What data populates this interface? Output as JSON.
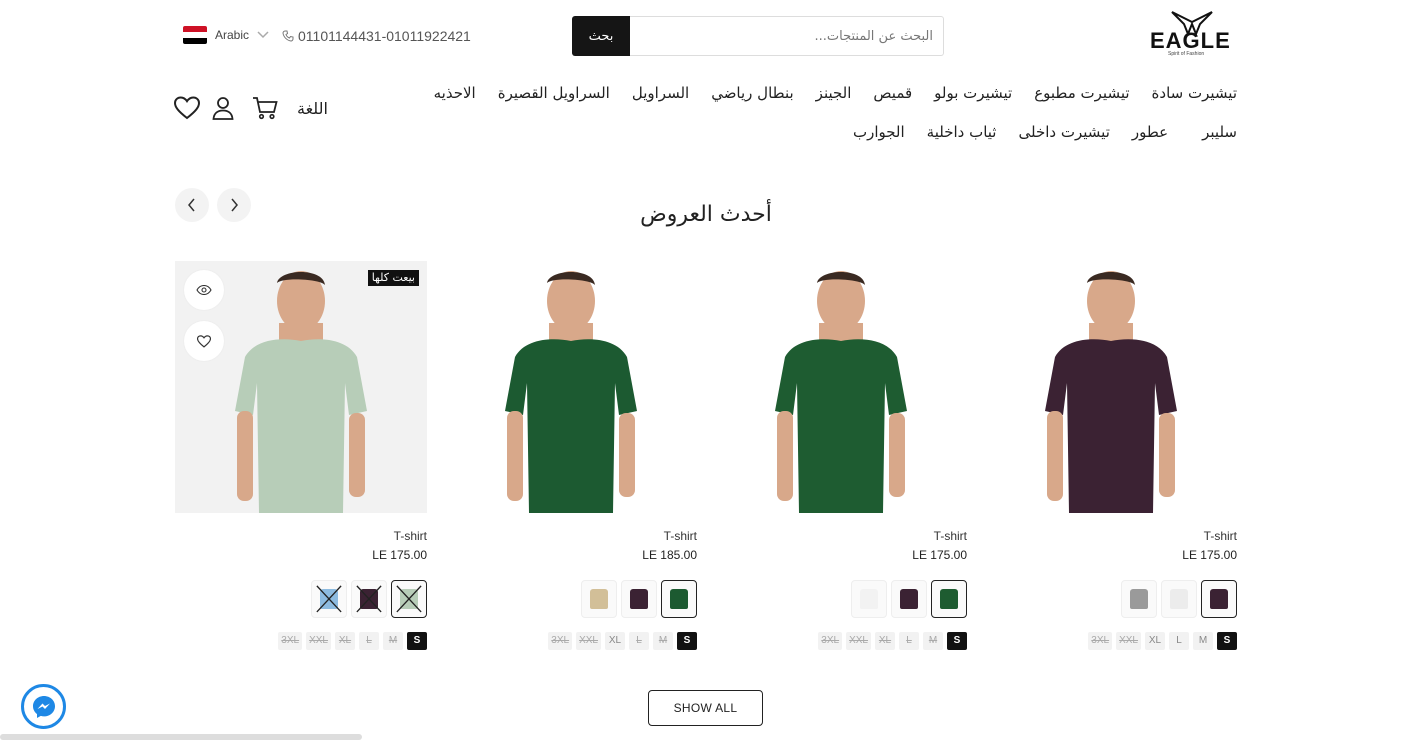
{
  "header": {
    "logo_text": "EAGLE",
    "logo_tagline": "Spirit of Fashion",
    "search_button": "بحث",
    "search_placeholder": "البحث عن المنتجات...",
    "phone": "01101144431-01011922421",
    "language": "Arabic",
    "language_label": "اللغة"
  },
  "nav": {
    "items": [
      "تيشيرت سادة",
      "تيشيرت مطبوع",
      "تيشيرت بولو",
      "قميص",
      "الجينز",
      "بنطال رياضي",
      "السراويل",
      "السراويل القصيرة",
      "الاحذيه",
      "سليبر",
      "عطور",
      "تيشيرت داخلى",
      "ثياب داخلية",
      "الجوارب"
    ]
  },
  "section": {
    "title": "أحدث العروض",
    "show_all": "SHOW ALL"
  },
  "products": [
    {
      "name": "T-shirt",
      "price": "LE 175.00",
      "color": "#3b2233",
      "swatches": [
        {
          "color": "#3b2233",
          "selected": true,
          "crossed": false
        },
        {
          "color": "#ececec",
          "selected": false,
          "crossed": false
        },
        {
          "color": "#9a9a9a",
          "selected": false,
          "crossed": false
        }
      ],
      "sizes": [
        {
          "label": "S",
          "state": "selected"
        },
        {
          "label": "M",
          "state": "available"
        },
        {
          "label": "L",
          "state": "available"
        },
        {
          "label": "XL",
          "state": "available"
        },
        {
          "label": "XXL",
          "state": "out"
        },
        {
          "label": "3XL",
          "state": "out"
        }
      ]
    },
    {
      "name": "T-shirt",
      "price": "LE 175.00",
      "color": "#1e5c31",
      "swatches": [
        {
          "color": "#1e5c31",
          "selected": true,
          "crossed": false
        },
        {
          "color": "#3b2233",
          "selected": false,
          "crossed": false
        },
        {
          "color": "#f2f2f2",
          "selected": false,
          "crossed": false
        }
      ],
      "sizes": [
        {
          "label": "S",
          "state": "selected"
        },
        {
          "label": "M",
          "state": "out"
        },
        {
          "label": "L",
          "state": "out"
        },
        {
          "label": "XL",
          "state": "out"
        },
        {
          "label": "XXL",
          "state": "out"
        },
        {
          "label": "3XL",
          "state": "out"
        }
      ]
    },
    {
      "name": "T-shirt",
      "price": "LE 185.00",
      "color": "#1c5a31",
      "swatches": [
        {
          "color": "#1c5a31",
          "selected": true,
          "crossed": false
        },
        {
          "color": "#3b2233",
          "selected": false,
          "crossed": false
        },
        {
          "color": "#d2bf98",
          "selected": false,
          "crossed": false
        }
      ],
      "sizes": [
        {
          "label": "S",
          "state": "selected"
        },
        {
          "label": "M",
          "state": "out"
        },
        {
          "label": "L",
          "state": "out"
        },
        {
          "label": "XL",
          "state": "available"
        },
        {
          "label": "XXL",
          "state": "out"
        },
        {
          "label": "3XL",
          "state": "out"
        }
      ]
    },
    {
      "name": "T-shirt",
      "price": "LE 175.00",
      "color": "#b7cdb8",
      "sold_out": "بيعت كلها",
      "swatches": [
        {
          "color": "#b7cdb8",
          "selected": true,
          "crossed": true
        },
        {
          "color": "#3b2233",
          "selected": false,
          "crossed": true
        },
        {
          "color": "#8dbbe0",
          "selected": false,
          "crossed": true
        }
      ],
      "sizes": [
        {
          "label": "S",
          "state": "selected"
        },
        {
          "label": "M",
          "state": "out"
        },
        {
          "label": "L",
          "state": "out"
        },
        {
          "label": "XL",
          "state": "out"
        },
        {
          "label": "XXL",
          "state": "out"
        },
        {
          "label": "3XL",
          "state": "out"
        }
      ]
    }
  ],
  "colors": {
    "accent": "#151515",
    "messenger": "#1e88e5",
    "flag_red": "#ce1126",
    "flag_white": "#ffffff",
    "flag_black": "#000000"
  },
  "icons": {
    "phone": "phone-icon",
    "chevron": "chevron-down-icon",
    "cart": "cart-icon",
    "user": "user-icon",
    "wishlist": "heart-icon",
    "quick_view": "eye-icon",
    "messenger": "messenger-icon"
  }
}
